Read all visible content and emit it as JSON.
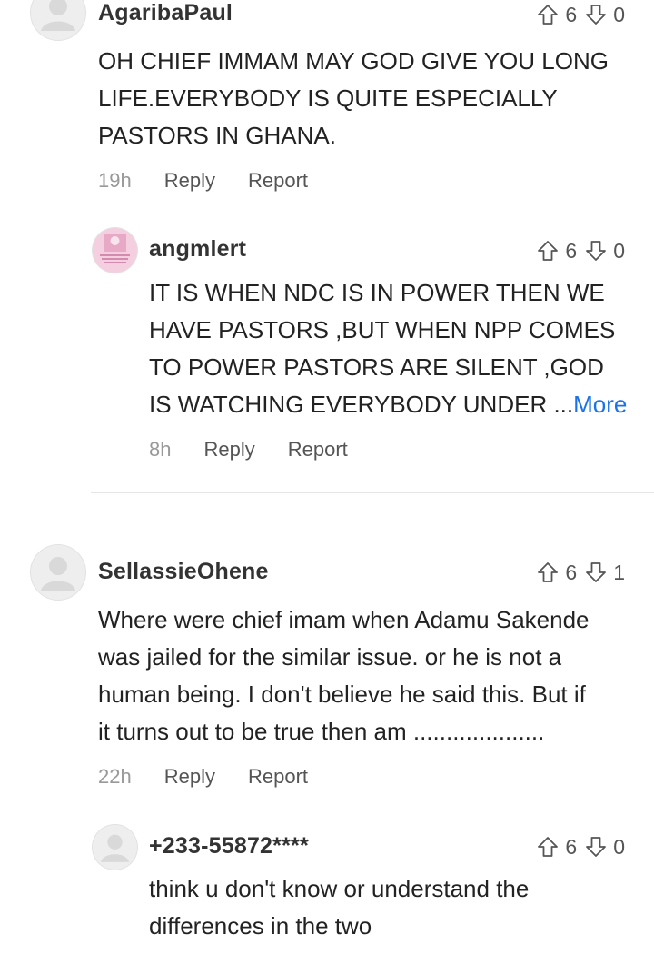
{
  "comments": [
    {
      "user": "AgaribaPaul",
      "up": "6",
      "down": "0",
      "lines": [
        "OH CHIEF IMMAM MAY GOD GIVE YOU LONG",
        "LIFE.EVERYBODY IS QUITE ESPECIALLY",
        "PASTORS IN GHANA."
      ],
      "time": "19h",
      "reply": "Reply",
      "report": "Report"
    },
    {
      "user": "angmlert",
      "up": "6",
      "down": "0",
      "lines": [
        "IT IS WHEN NDC IS IN POWER THEN WE",
        "HAVE PASTORS ,BUT WHEN NPP COMES",
        "TO POWER PASTORS ARE SILENT ,GOD",
        "IS WATCHING EVERYBODY UNDER ..."
      ],
      "more": "More",
      "time": "8h",
      "reply": "Reply",
      "report": "Report"
    },
    {
      "user": "SellassieOhene",
      "up": "6",
      "down": "1",
      "lines": [
        "Where were chief imam when Adamu Sakende",
        "was jailed for the similar issue. or he is not a",
        "human being. I don't believe he said this. But if",
        "it turns out to be true then am ...................."
      ],
      "time": "22h",
      "reply": "Reply",
      "report": "Report"
    },
    {
      "user": "+233-55872****",
      "up": "6",
      "down": "0",
      "lines": [
        "think u don't know or understand the",
        "differences in the two"
      ]
    }
  ],
  "icons": {
    "upvote": "arrow-up-outline-icon",
    "downvote": "arrow-down-outline-icon",
    "avatar": "default-user-icon"
  },
  "colors": {
    "link": "#1a73e8",
    "text": "#222222",
    "muted": "#999999"
  }
}
